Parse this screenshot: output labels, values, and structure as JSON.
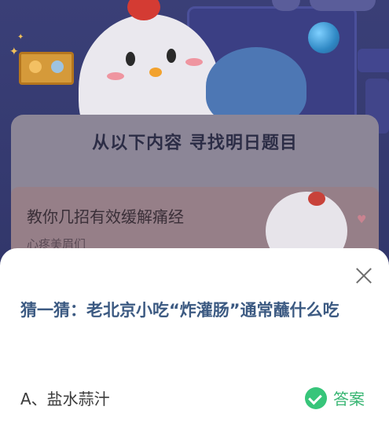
{
  "banner": {
    "heading": "从以下内容 寻找明日题目"
  },
  "article": {
    "title": "教你几招有效缓解痛经",
    "subtitle": "心疼美眉们"
  },
  "quiz": {
    "question": "猜一猜：老北京小吃“炸灌肠”通常蘸什么吃",
    "options": [
      {
        "label": "A、盐水蒜汁"
      }
    ],
    "answer_label": "答案",
    "answer_color": "#37c57a"
  },
  "icons": [
    "close-icon",
    "check-icon",
    "star-icon"
  ]
}
